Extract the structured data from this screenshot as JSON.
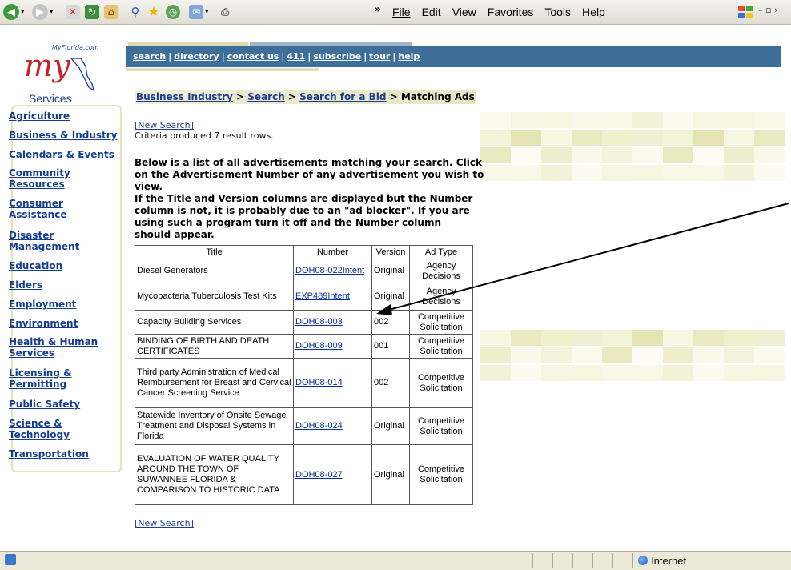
{
  "toolbar": {
    "menu": [
      "File",
      "Edit",
      "View",
      "Favorites",
      "Tools",
      "Help"
    ],
    "chevron": "»"
  },
  "logo": {
    "site": "MyFlorida.com",
    "my": "my",
    "services": "Services"
  },
  "sidebar": {
    "items": [
      "Agriculture",
      "Business & Industry",
      "Calendars & Events",
      "Community Resources",
      "Consumer Assistance",
      "Disaster Management",
      "Education",
      "Elders",
      "Employment",
      "Environment",
      "Health & Human Services",
      "Licensing & Permitting",
      "Public Safety",
      "Science & Technology",
      "Transportation"
    ]
  },
  "topnav": [
    "search",
    "directory",
    "contact us",
    "411",
    "subscribe",
    "tour",
    "help"
  ],
  "breadcrumb": {
    "links": [
      "Business Industry",
      "Search",
      "Search for a Bid"
    ],
    "current": "Matching Ads"
  },
  "content": {
    "new_search": "[New Search]",
    "criteria": "Criteria produced 7 result rows.",
    "intro": "Below is a list of all advertisements matching your search. Click on the Advertisement Number of any advertisement you wish to view.",
    "note": "If the Title and Version columns are displayed but the Number column is not, it is probably due to an \"ad blocker\". If you are using such a program turn it off and the Number column should appear.",
    "new_search_bottom": "[New Search]"
  },
  "table": {
    "headers": [
      "Title",
      "Number",
      "Version",
      "Ad Type"
    ],
    "rows": [
      {
        "title": "Diesel Generators",
        "number": "DOH08-022Intent",
        "version": "Original",
        "ad_type": "Agency Decisions"
      },
      {
        "title": "Mycobacteria Tuberculosis Test Kits",
        "number": "EXP489Intent",
        "version": "Original",
        "ad_type": "Agency Decisions"
      },
      {
        "title": "Capacity Building Services",
        "number": "DOH08-003",
        "version": "002",
        "ad_type": "Competitive Solicitation"
      },
      {
        "title": "BINDING OF BIRTH AND DEATH CERTIFICATES",
        "number": "DOH08-009",
        "version": "001",
        "ad_type": "Competitive Solicitation"
      },
      {
        "title": "Third party Administration of Medical Reimbursement for Breast and Cervical Cancer Screening Service",
        "number": "DOH08-014",
        "version": "002",
        "ad_type": "Competitive Solicitation"
      },
      {
        "title": "Statewide Inventory of Onsite Sewage Treatment and Disposal Systems in Florida",
        "number": "DOH08-024",
        "version": "Original",
        "ad_type": "Competitive Solicitation"
      },
      {
        "title": "EVALUATION OF WATER QUALITY AROUND THE TOWN OF SUWANNEE FLORIDA & COMPARISON TO HISTORIC DATA",
        "number": "DOH08-027",
        "version": "Original",
        "ad_type": "Competitive Solicitation"
      }
    ]
  },
  "statusbar": {
    "zone": "Internet"
  },
  "colors": {
    "banner": "#3d6f9a",
    "link": "#143d8f",
    "logo_red": "#c82126"
  }
}
